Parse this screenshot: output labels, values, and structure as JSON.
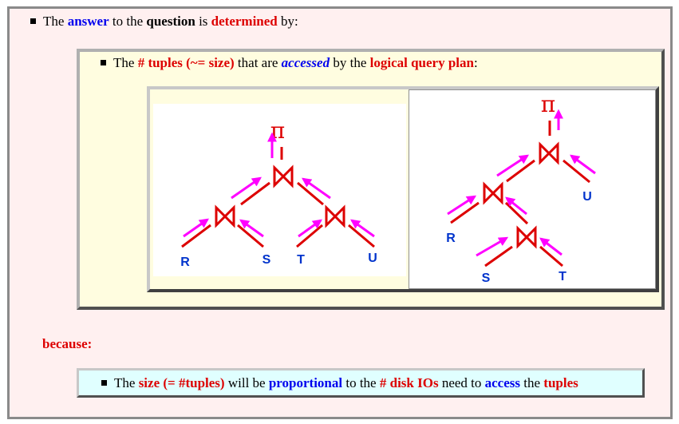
{
  "line1": {
    "t1": "The ",
    "t2": "answer",
    "t3": " to the ",
    "t4": "question",
    "t5": " is ",
    "t6": "determined",
    "t7": " by:"
  },
  "line2": {
    "t1": "The ",
    "t2": "# tuples (~= size)",
    "t3": " that are ",
    "t4": "accessed",
    "t5": " by the ",
    "t6": "logical query plan",
    "t7": ":"
  },
  "because": "because:",
  "line3": {
    "t1": "The ",
    "t2": "size (= #tuples)",
    "t3": " will be ",
    "t4": "proportional",
    "t5": " to the ",
    "t6": "# disk IOs",
    "t7": " need to ",
    "t8": "access",
    "t9": " the ",
    "t10": "tuples"
  },
  "plan_left": {
    "projection": "π",
    "leaves": [
      "R",
      "S",
      "T",
      "U"
    ]
  },
  "plan_right": {
    "projection": "π",
    "leaves": [
      "R",
      "S",
      "T",
      "U"
    ]
  },
  "colors": {
    "join": "#dd0000",
    "arrow": "#ff00ff",
    "leaf": "#0033cc"
  }
}
